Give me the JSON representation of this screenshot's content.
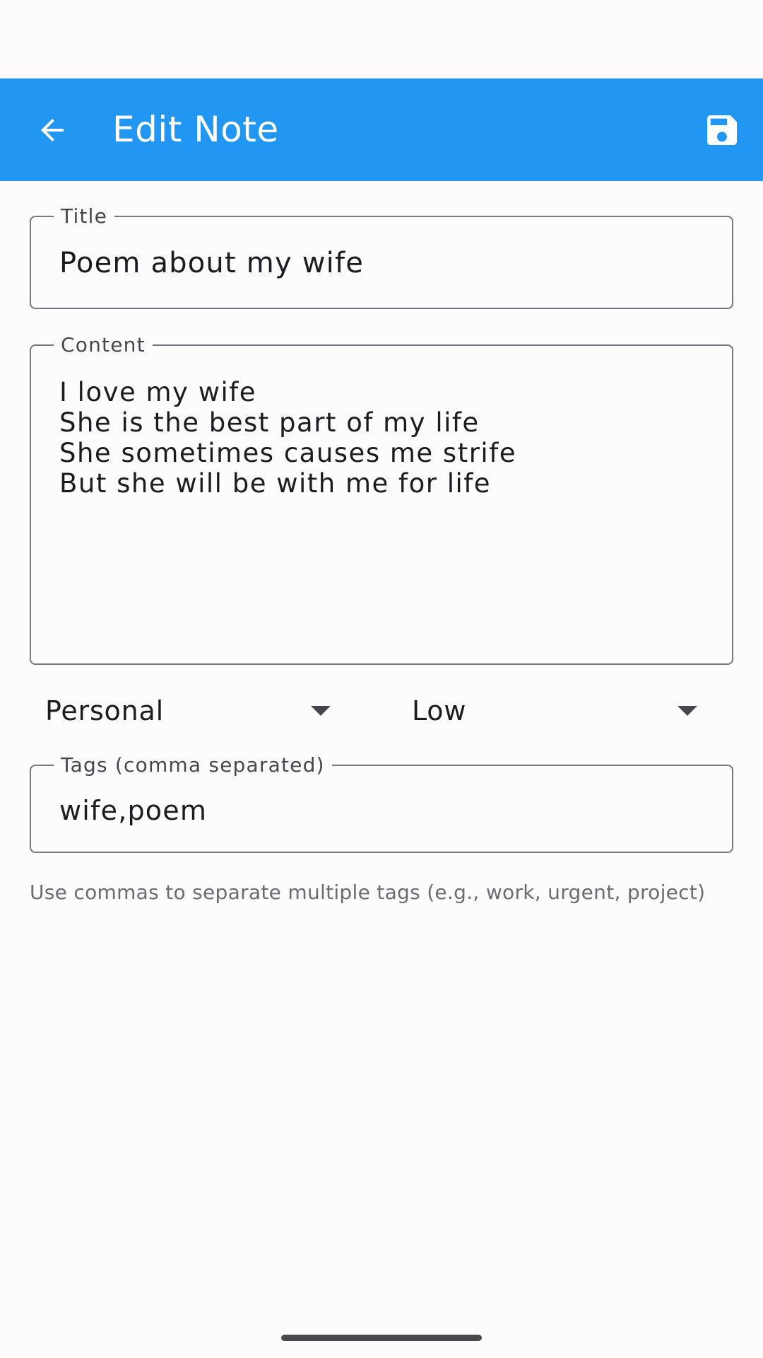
{
  "app_bar": {
    "title": "Edit Note",
    "back_icon": "arrow-back-icon",
    "save_icon": "save-icon",
    "background_color": "#2196f3"
  },
  "form": {
    "title_field": {
      "label": "Title",
      "value": "Poem about my wife"
    },
    "content_field": {
      "label": "Content",
      "lines": [
        "I love my wife",
        "She is the best part of my life",
        "She sometimes causes me strife",
        "But she will be with me for life"
      ]
    },
    "category_dropdown": {
      "selected": "Personal"
    },
    "priority_dropdown": {
      "selected": "Low"
    },
    "tags_field": {
      "label": "Tags (comma separated)",
      "value": "wife,poem"
    },
    "helper_text": "Use commas to separate multiple tags (e.g., work, urgent, project)"
  }
}
